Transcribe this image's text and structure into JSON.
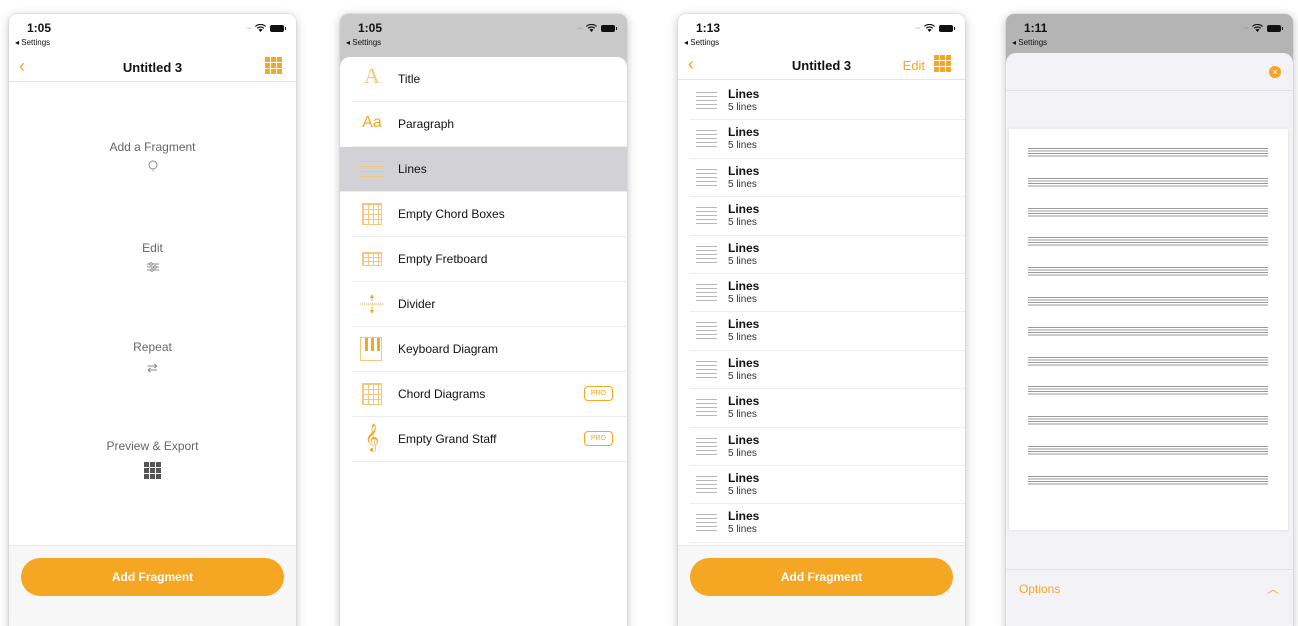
{
  "colors": {
    "accent": "#f5a623",
    "sheet_bg": "#f2f2f7"
  },
  "status": {
    "p1_time": "1:05",
    "p2_time": "1:05",
    "p3_time": "1:13",
    "p4_time": "1:11",
    "back_app": "◂ Settings"
  },
  "screen1": {
    "title": "Untitled 3",
    "hints": [
      {
        "label": "Add a Fragment",
        "icon": "lightbulb-icon"
      },
      {
        "label": "Edit",
        "icon": "sliders-icon"
      },
      {
        "label": "Repeat",
        "icon": "repeat-icon"
      },
      {
        "label": "Preview & Export",
        "icon": "grid-icon"
      }
    ],
    "add_button": "Add Fragment"
  },
  "screen2": {
    "items": [
      {
        "label": "Title",
        "icon": "title-icon"
      },
      {
        "label": "Paragraph",
        "icon": "paragraph-icon"
      },
      {
        "label": "Lines",
        "icon": "lines-icon",
        "selected": true
      },
      {
        "label": "Empty Chord Boxes",
        "icon": "chord-boxes-icon"
      },
      {
        "label": "Empty Fretboard",
        "icon": "fretboard-icon"
      },
      {
        "label": "Divider",
        "icon": "divider-icon"
      },
      {
        "label": "Keyboard Diagram",
        "icon": "keyboard-icon"
      },
      {
        "label": "Chord Diagrams",
        "icon": "chord-diagram-icon",
        "pro": "PRO"
      },
      {
        "label": "Empty Grand Staff",
        "icon": "treble-clef-icon",
        "pro": "PRO"
      }
    ]
  },
  "screen3": {
    "title": "Untitled 3",
    "edit": "Edit",
    "row_title": "Lines",
    "row_sub": "5 lines",
    "add_button": "Add Fragment"
  },
  "screen4": {
    "options": "Options"
  }
}
